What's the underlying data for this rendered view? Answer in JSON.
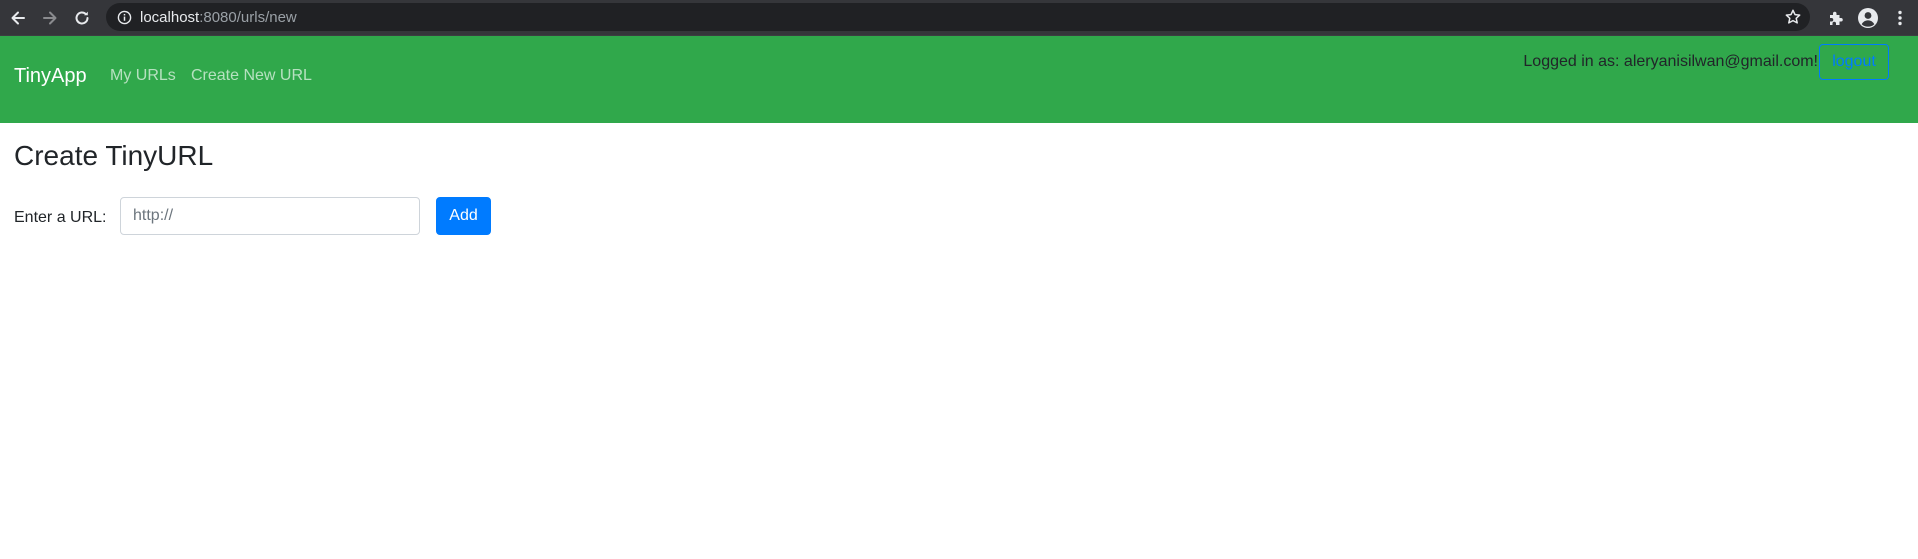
{
  "browser": {
    "url_host": "localhost",
    "url_path": ":8080/urls/new"
  },
  "navbar": {
    "brand": "TinyApp",
    "links": [
      {
        "label": "My URLs"
      },
      {
        "label": "Create New URL"
      }
    ],
    "login_status": "Logged in as: aleryanisilwan@gmail.com!",
    "logout_label": "logout"
  },
  "main": {
    "title": "Create TinyURL",
    "form": {
      "label": "Enter a URL:",
      "input_placeholder": "http://",
      "input_value": "",
      "submit_label": "Add"
    }
  },
  "colors": {
    "navbar_bg": "#30a84b",
    "primary": "#007bff"
  }
}
